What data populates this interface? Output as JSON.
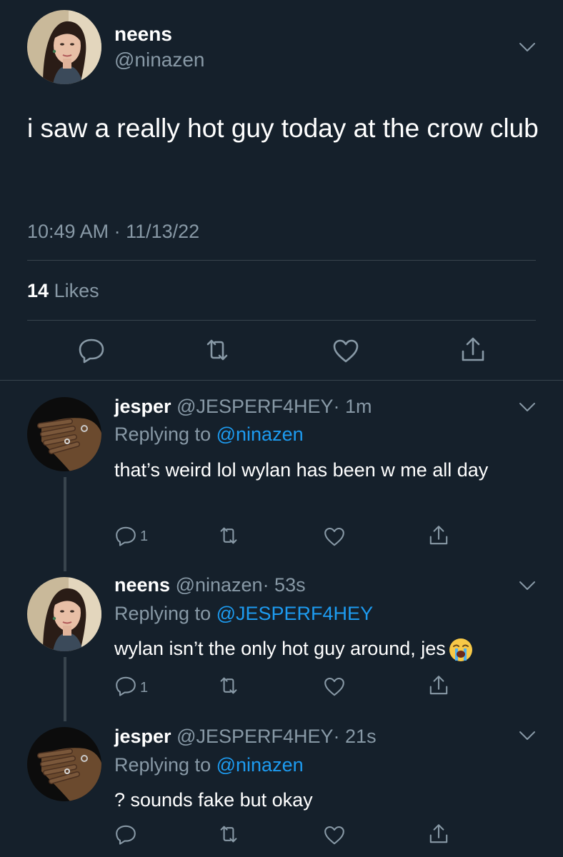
{
  "main_tweet": {
    "display_name": "neens",
    "handle": "@ninazen",
    "text": "i saw a really hot guy today at the crow club",
    "timestamp": "10:49 AM · 11/13/22",
    "likes_count": "14",
    "likes_label": "Likes"
  },
  "replies": [
    {
      "display_name": "jesper",
      "handle": "@JESPERF4HEY",
      "time": "· 1m",
      "replying_label": "Replying to",
      "replying_to": "@ninazen",
      "text": "that’s weird lol wylan has been w me all day",
      "reply_count": "1"
    },
    {
      "display_name": "neens",
      "handle": "@ninazen",
      "time": "· 53s",
      "replying_label": "Replying to",
      "replying_to": "@JESPERF4HEY",
      "text": "wylan isn’t the only hot guy around, jes",
      "emoji": "loudly-crying-face-emoji",
      "reply_count": "1"
    },
    {
      "display_name": "jesper",
      "handle": "@JESPERF4HEY",
      "time": "· 21s",
      "replying_label": "Replying to",
      "replying_to": "@ninazen",
      "text": "? sounds fake but okay",
      "reply_count": ""
    }
  ],
  "colors": {
    "background": "#15202b",
    "muted_text": "#8899a6",
    "link": "#1d9bf0",
    "divider": "#38444d"
  },
  "icons": [
    "chevron-down-icon",
    "reply-icon",
    "retweet-icon",
    "like-icon",
    "share-icon"
  ]
}
